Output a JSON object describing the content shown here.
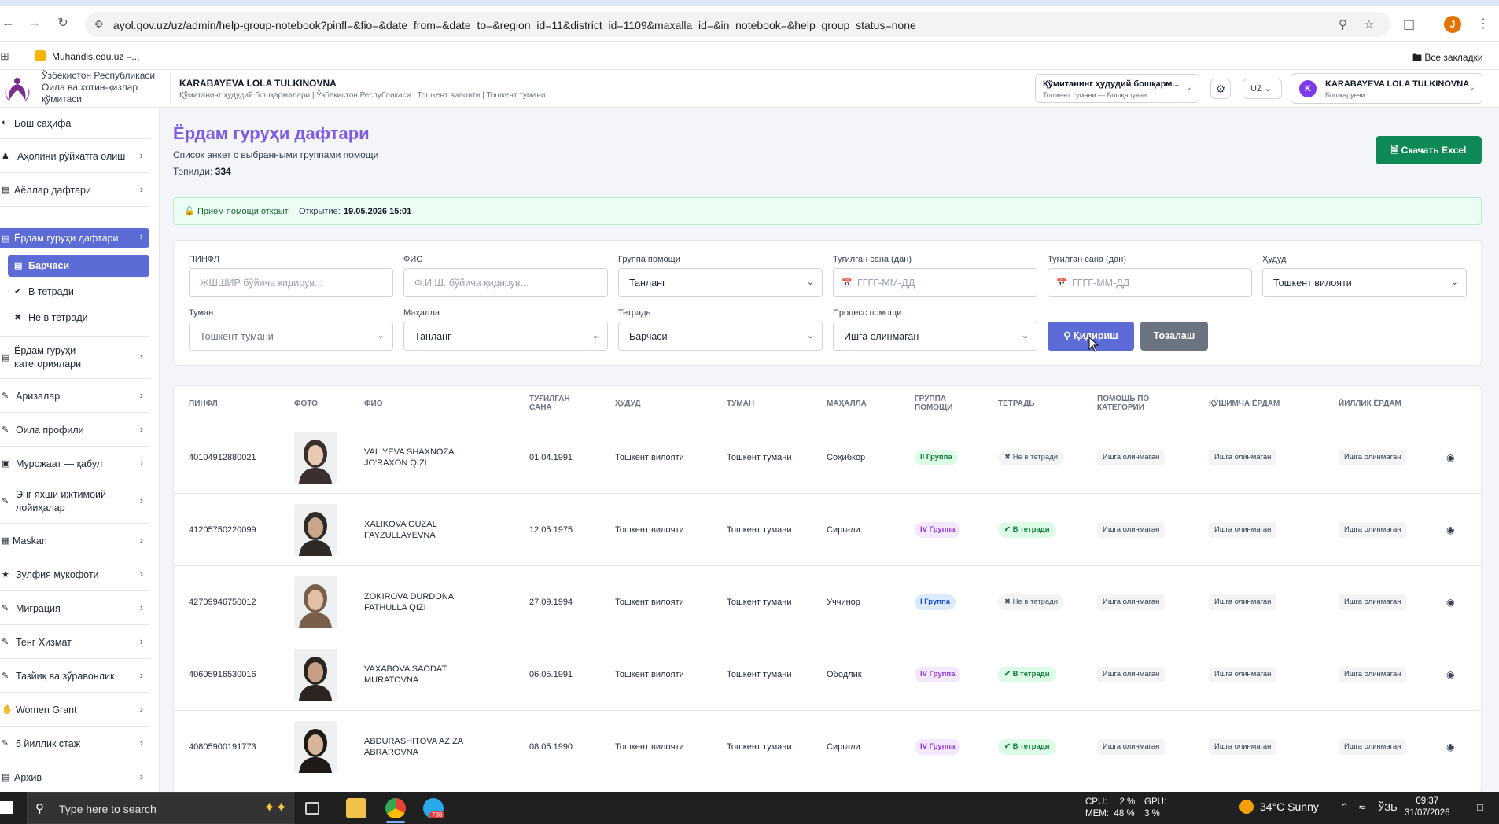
{
  "browser": {
    "url": "ayol.gov.uz/uz/admin/help-group-notebook?pinfl=&fio=&date_from=&date_to=&region_id=11&district_id=1109&maxalla_id=&in_notebook=&help_group_status=none",
    "profile_initial": "J",
    "bookmark": "Muhandis.edu.uz –...",
    "all_bookmarks": "Все закладки"
  },
  "header": {
    "org_name": "Ўзбекистон Республикаси Оила ва хотин-қизлар қўмитаси",
    "user_title": "KARABAYEVA LOLA TULKINOVNA",
    "user_path": "Қўмитанинг ҳудудий бошқармалари | Ўзбекистон Республикаси | Тошкент вилояти | Тошкент тумани",
    "role_line1": "Қўмитанинг ҳудудий бошқарм...",
    "role_line2": "Тошкент тумани — Бошқарувчи",
    "lang": "UZ",
    "user_initial": "K",
    "user_name": "KARABAYEVA LOLA TULKINOVNA",
    "user_role": "Бошқарувчи"
  },
  "sidebar": {
    "items": [
      {
        "label": "Бош саҳифа",
        "icon": "dashboard-icon"
      },
      {
        "label": "Аҳолини рўйхатга олиш",
        "icon": "people-icon"
      },
      {
        "label": "Аёллар дафтари",
        "icon": "book-icon"
      },
      {
        "label": "Ёрдам гуруҳи дафтари",
        "icon": "book-icon"
      },
      {
        "label": "Ёрдам гуруҳи категориялари",
        "icon": "book-icon"
      },
      {
        "label": "Аризалар",
        "icon": "edit-icon"
      },
      {
        "label": "Оила профили",
        "icon": "edit-icon"
      },
      {
        "label": "Мурожаат — қабул",
        "icon": "inbox-icon"
      },
      {
        "label": "Энг яхши ижтимоий лойиҳалар",
        "icon": "edit-icon"
      },
      {
        "label": "Maskan",
        "icon": "building-icon"
      },
      {
        "label": "Зулфия мукофоти",
        "icon": "award-icon"
      },
      {
        "label": "Миграция",
        "icon": "edit-icon"
      },
      {
        "label": "Тенг Хизмат",
        "icon": "edit-icon"
      },
      {
        "label": "Тазйиқ ва зўравонлик",
        "icon": "edit-icon"
      },
      {
        "label": "Women Grant",
        "icon": "hand-icon"
      },
      {
        "label": "5 йиллик стаж",
        "icon": "edit-icon"
      },
      {
        "label": "Архив",
        "icon": "archive-icon"
      }
    ],
    "subitems": [
      {
        "label": "Барчаси"
      },
      {
        "label": "В тетради"
      },
      {
        "label": "Не в тетради"
      }
    ]
  },
  "page": {
    "title": "Ёрдам гуруҳи дафтари",
    "subtitle": "Список анкет с выбранными группами помощи",
    "found_label": "Топилди:",
    "found_value": "334",
    "excel_label": "Скачать Excel"
  },
  "status": {
    "open_text": "Прием помощи открыт",
    "opened_label": "Открытие:",
    "opened_value": "19.05.2026 15:01"
  },
  "filters": {
    "pinfl_label": "ПИНФЛ",
    "pinfl_placeholder": "ЖШШИР бўйича қидирув...",
    "fio_label": "ФИО",
    "fio_placeholder": "Ф.И.Ш. бўйича қидирув...",
    "group_label": "Группа помощи",
    "group_value": "Танланг",
    "date_from_label": "Туғилган сана (дан)",
    "date_from_placeholder": "ГГГГ-ММ-ДД",
    "date_to_label": "Туғилган сана (дан)",
    "date_to_placeholder": "ГГГГ-ММ-ДД",
    "region_label": "Ҳудуд",
    "region_value": "Тошкент вилояти",
    "district_label": "Туман",
    "district_value": "Тошкент тумани",
    "mahalla_label": "Маҳалла",
    "mahalla_value": "Танланг",
    "notebook_label": "Тетрадь",
    "notebook_value": "Барчаси",
    "process_label": "Процесс помощи",
    "process_value": "Ишга олинмаган",
    "search_label": "Қидириш",
    "reset_label": "Тозалаш"
  },
  "table": {
    "headers": [
      "ПИНФЛ",
      "ФОТО",
      "ФИО",
      "ТУҒИЛГАН САНА",
      "ҲУДУД",
      "ТУМАН",
      "МАҲАЛЛА",
      "ГРУППА ПОМОЩИ",
      "ТЕТРАДЬ",
      "ПОМОЩЬ ПО КАТЕГОРИИ",
      "ҚЎШИМЧА ЁРДАМ",
      "ЙИЛЛИК ЁРДАМ"
    ],
    "rows": [
      {
        "pinfl": "40104912880021",
        "fio": "VALIYEVA SHAXNOZA JO'RAXON QIZI",
        "birth": "01.04.1991",
        "region": "Тошкент вилояти",
        "district": "Тошкент тумани",
        "mahalla": "Соҳибкор",
        "group": "II Группа",
        "group_class": "grp-ii",
        "notebook": "Не в тетради",
        "nb_class": "nb-out",
        "cat": "Ишга олинмаган",
        "extra": "Ишга олинмаган",
        "yearly": "Ишга олинмаган"
      },
      {
        "pinfl": "41205750220099",
        "fio": "XALIKOVA GUZAL FAYZULLAYEVNA",
        "birth": "12.05.1975",
        "region": "Тошкент вилояти",
        "district": "Тошкент тумани",
        "mahalla": "Сиргали",
        "group": "IV Группа",
        "group_class": "grp-iv",
        "notebook": "В тетради",
        "nb_class": "nb-in",
        "cat": "Ишга олинмаган",
        "extra": "Ишга олинмаган",
        "yearly": "Ишга олинмаган"
      },
      {
        "pinfl": "42709946750012",
        "fio": "ZOKIROVA DURDONA FATHULLA QIZI",
        "birth": "27.09.1994",
        "region": "Тошкент вилояти",
        "district": "Тошкент тумани",
        "mahalla": "Уччинор",
        "group": "I Группа",
        "group_class": "grp-i",
        "notebook": "Не в тетради",
        "nb_class": "nb-out",
        "cat": "Ишга олинмаган",
        "extra": "Ишга олинмаган",
        "yearly": "Ишга олинмаган"
      },
      {
        "pinfl": "40605916530016",
        "fio": "VAXABOVA SAODAT MURATOVNA",
        "birth": "06.05.1991",
        "region": "Тошкент вилояти",
        "district": "Тошкент тумани",
        "mahalla": "Ободлик",
        "group": "IV Группа",
        "group_class": "grp-iv",
        "notebook": "В тетради",
        "nb_class": "nb-in",
        "cat": "Ишга олинмаган",
        "extra": "Ишга олинмаган",
        "yearly": "Ишга олинмаган"
      },
      {
        "pinfl": "40805900191773",
        "fio": "ABDURASHITOVA AZIZA ABRAROVNA",
        "birth": "08.05.1990",
        "region": "Тошкент вилояти",
        "district": "Тошкент тумани",
        "mahalla": "Сиргали",
        "group": "IV Группа",
        "group_class": "grp-iv",
        "notebook": "В тетради",
        "nb_class": "nb-in",
        "cat": "Ишга олинмаган",
        "extra": "Ишга олинмаган",
        "yearly": "Ишга олинмаган"
      }
    ]
  },
  "taskbar": {
    "search_placeholder": "Type here to search",
    "telegram_badge": "788",
    "cpu_label": "CPU:",
    "cpu_value": "2 %",
    "gpu_label": "GPU:",
    "gpu_value": "3 %",
    "mem_label": "MEM:",
    "mem_value": "48 %",
    "weather": "34°C  Sunny",
    "lang": "ЎЗБ",
    "time": "09:37",
    "date": "31/07/2026"
  }
}
